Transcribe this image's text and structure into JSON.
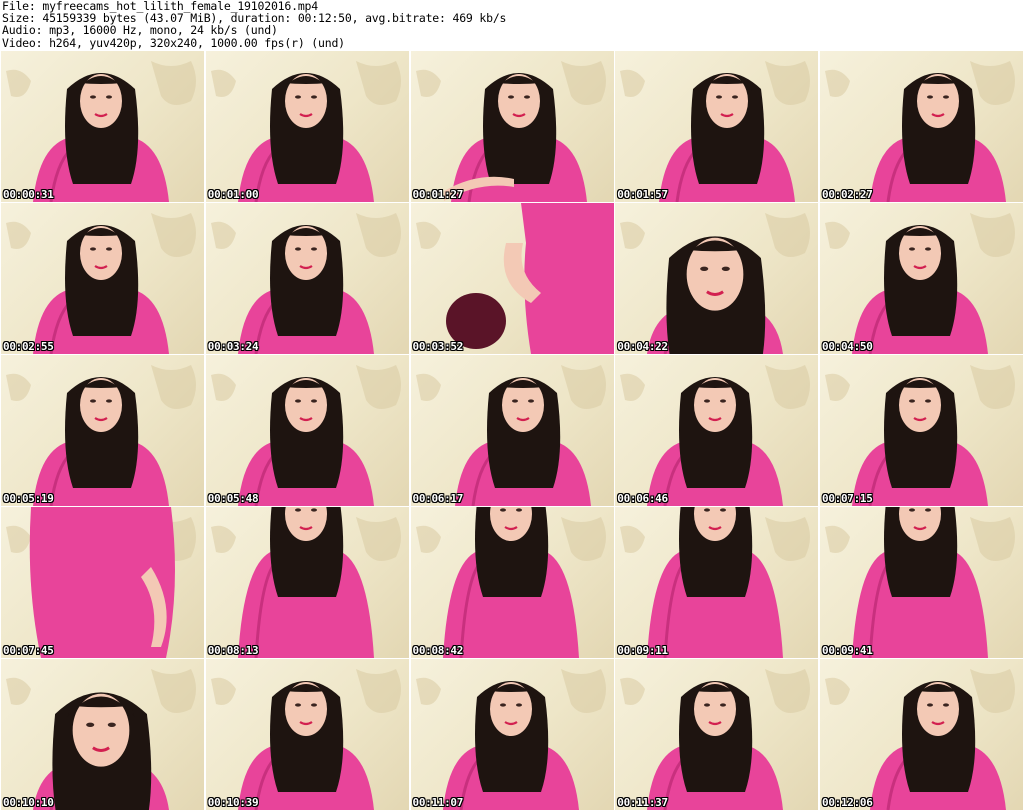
{
  "header": {
    "file_line": "File: myfreecams_hot_lilith_female_19102016.mp4",
    "size_line": "Size: 45159339 bytes (43.07 MiB), duration: 00:12:50, avg.bitrate: 469 kb/s",
    "audio_line": "Audio: mp3, 16000 Hz, mono, 24 kb/s (und)",
    "video_line": "Video: h264, yuv420p, 320x240, 1000.00 fps(r) (und)"
  },
  "colors": {
    "dress": "#e8449a",
    "dress_shadow": "#c8307e",
    "hair": "#1e1410",
    "skin": "#f3c9b5",
    "wall": "#f4eed6",
    "map": "#d9cba3"
  },
  "thumbnails": [
    {
      "timestamp": "00:00:31",
      "pose": "center"
    },
    {
      "timestamp": "00:01:00",
      "pose": "center"
    },
    {
      "timestamp": "00:01:27",
      "pose": "arms"
    },
    {
      "timestamp": "00:01:57",
      "pose": "tilt"
    },
    {
      "timestamp": "00:02:27",
      "pose": "right"
    },
    {
      "timestamp": "00:02:55",
      "pose": "center"
    },
    {
      "timestamp": "00:03:24",
      "pose": "center"
    },
    {
      "timestamp": "00:03:52",
      "pose": "chair"
    },
    {
      "timestamp": "00:04:22",
      "pose": "close"
    },
    {
      "timestamp": "00:04:50",
      "pose": "center"
    },
    {
      "timestamp": "00:05:19",
      "pose": "center"
    },
    {
      "timestamp": "00:05:48",
      "pose": "center"
    },
    {
      "timestamp": "00:06:17",
      "pose": "tilt"
    },
    {
      "timestamp": "00:06:46",
      "pose": "center"
    },
    {
      "timestamp": "00:07:15",
      "pose": "center"
    },
    {
      "timestamp": "00:07:45",
      "pose": "body"
    },
    {
      "timestamp": "00:08:13",
      "pose": "low"
    },
    {
      "timestamp": "00:08:42",
      "pose": "low"
    },
    {
      "timestamp": "00:09:11",
      "pose": "low"
    },
    {
      "timestamp": "00:09:41",
      "pose": "low"
    },
    {
      "timestamp": "00:10:10",
      "pose": "close"
    },
    {
      "timestamp": "00:10:39",
      "pose": "center"
    },
    {
      "timestamp": "00:11:07",
      "pose": "center"
    },
    {
      "timestamp": "00:11:37",
      "pose": "center"
    },
    {
      "timestamp": "00:12:06",
      "pose": "right"
    }
  ]
}
